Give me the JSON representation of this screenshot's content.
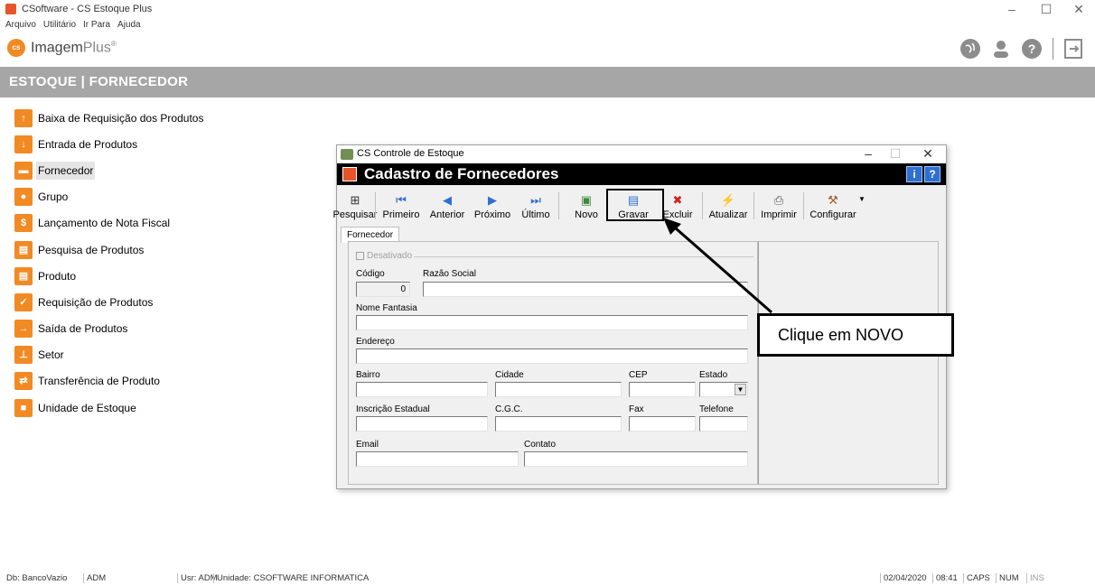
{
  "window": {
    "title": "CSoftware - CS Estoque Plus",
    "controls": {
      "minimize": "–",
      "maximize": "☐",
      "close": "✕"
    }
  },
  "menu": [
    "Arquivo",
    "Utilitário",
    "Ir Para",
    "Ajuda"
  ],
  "brand": {
    "logo_badge": "cs",
    "name": "Imagem",
    "suffix": "Plus",
    "mark": "®"
  },
  "top_icons": {
    "globe": "globe-icon",
    "user": "user-icon",
    "help": "?",
    "exit": "exit-icon"
  },
  "section_header": "ESTOQUE | FORNECEDOR",
  "sidebar": {
    "items": [
      {
        "label": "Baixa de Requisição dos Produtos",
        "icon": "box-up-icon",
        "glyph": "↑"
      },
      {
        "label": "Entrada de Produtos",
        "icon": "box-in-icon",
        "glyph": "↓"
      },
      {
        "label": "Fornecedor",
        "icon": "truck-icon",
        "glyph": "▬",
        "selected": true
      },
      {
        "label": "Grupo",
        "icon": "group-icon",
        "glyph": "●"
      },
      {
        "label": "Lançamento de Nota Fiscal",
        "icon": "money-icon",
        "glyph": "$"
      },
      {
        "label": "Pesquisa de Produtos",
        "icon": "database-icon",
        "glyph": "▤"
      },
      {
        "label": "Produto",
        "icon": "database-icon",
        "glyph": "▤"
      },
      {
        "label": "Requisição de Produtos",
        "icon": "checklist-icon",
        "glyph": "✓"
      },
      {
        "label": "Saída de Produtos",
        "icon": "box-out-icon",
        "glyph": "→"
      },
      {
        "label": "Setor",
        "icon": "org-chart-icon",
        "glyph": "⊥"
      },
      {
        "label": "Transferência de Produto",
        "icon": "transfer-icon",
        "glyph": "⇄"
      },
      {
        "label": "Unidade de Estoque",
        "icon": "unit-icon",
        "glyph": "■"
      }
    ]
  },
  "dialog": {
    "window_title": "CS Controle de Estoque",
    "header": "Cadastro de Fornecedores",
    "header_buttons": [
      "i",
      "?"
    ],
    "toolbar": [
      {
        "label": "Pesquisar",
        "icon": "binoculars-icon",
        "glyph": "⊞"
      },
      {
        "label": "Primeiro",
        "icon": "first-icon",
        "glyph": "⏮"
      },
      {
        "label": "Anterior",
        "icon": "prev-icon",
        "glyph": "◀"
      },
      {
        "label": "Próximo",
        "icon": "next-icon",
        "glyph": "▶"
      },
      {
        "label": "Último",
        "icon": "last-icon",
        "glyph": "⏭"
      },
      {
        "label": "Novo",
        "icon": "new-doc-icon",
        "glyph": "▣"
      },
      {
        "label": "Gravar",
        "icon": "save-icon",
        "glyph": "▤"
      },
      {
        "label": "Excluir",
        "icon": "delete-icon",
        "glyph": "✖"
      },
      {
        "label": "Atualizar",
        "icon": "refresh-icon",
        "glyph": "⚡"
      },
      {
        "label": "Imprimir",
        "icon": "print-icon",
        "glyph": "⎙"
      },
      {
        "label": "Configurar",
        "icon": "wrench-icon",
        "glyph": "⚒"
      }
    ],
    "tab": "Fornecedor",
    "form": {
      "desativado": "Desativado",
      "codigo_label": "Código",
      "codigo_value": "0",
      "razao_social_label": "Razão Social",
      "nome_fantasia_label": "Nome Fantasia",
      "endereco_label": "Endereço",
      "bairro_label": "Bairro",
      "cidade_label": "Cidade",
      "cep_label": "CEP",
      "estado_label": "Estado",
      "inscricao_label": "Inscrição Estadual",
      "cgc_label": "C.G.C.",
      "fax_label": "Fax",
      "telefone_label": "Telefone",
      "email_label": "Email",
      "contato_label": "Contato"
    }
  },
  "callout": "Clique em NOVO",
  "status": {
    "db": "Db: BancoVazio",
    "adm": "ADM",
    "user": "Usr: ADM",
    "unidade": "Unidade: CSOFTWARE INFORMATICA",
    "date": "02/04/2020",
    "time": "08:41",
    "caps": "CAPS",
    "num": "NUM",
    "ins": "INS"
  },
  "colors": {
    "accent_orange": "#f28a24",
    "header_gray": "#a6a6a6",
    "dialog_header": "#000000"
  }
}
